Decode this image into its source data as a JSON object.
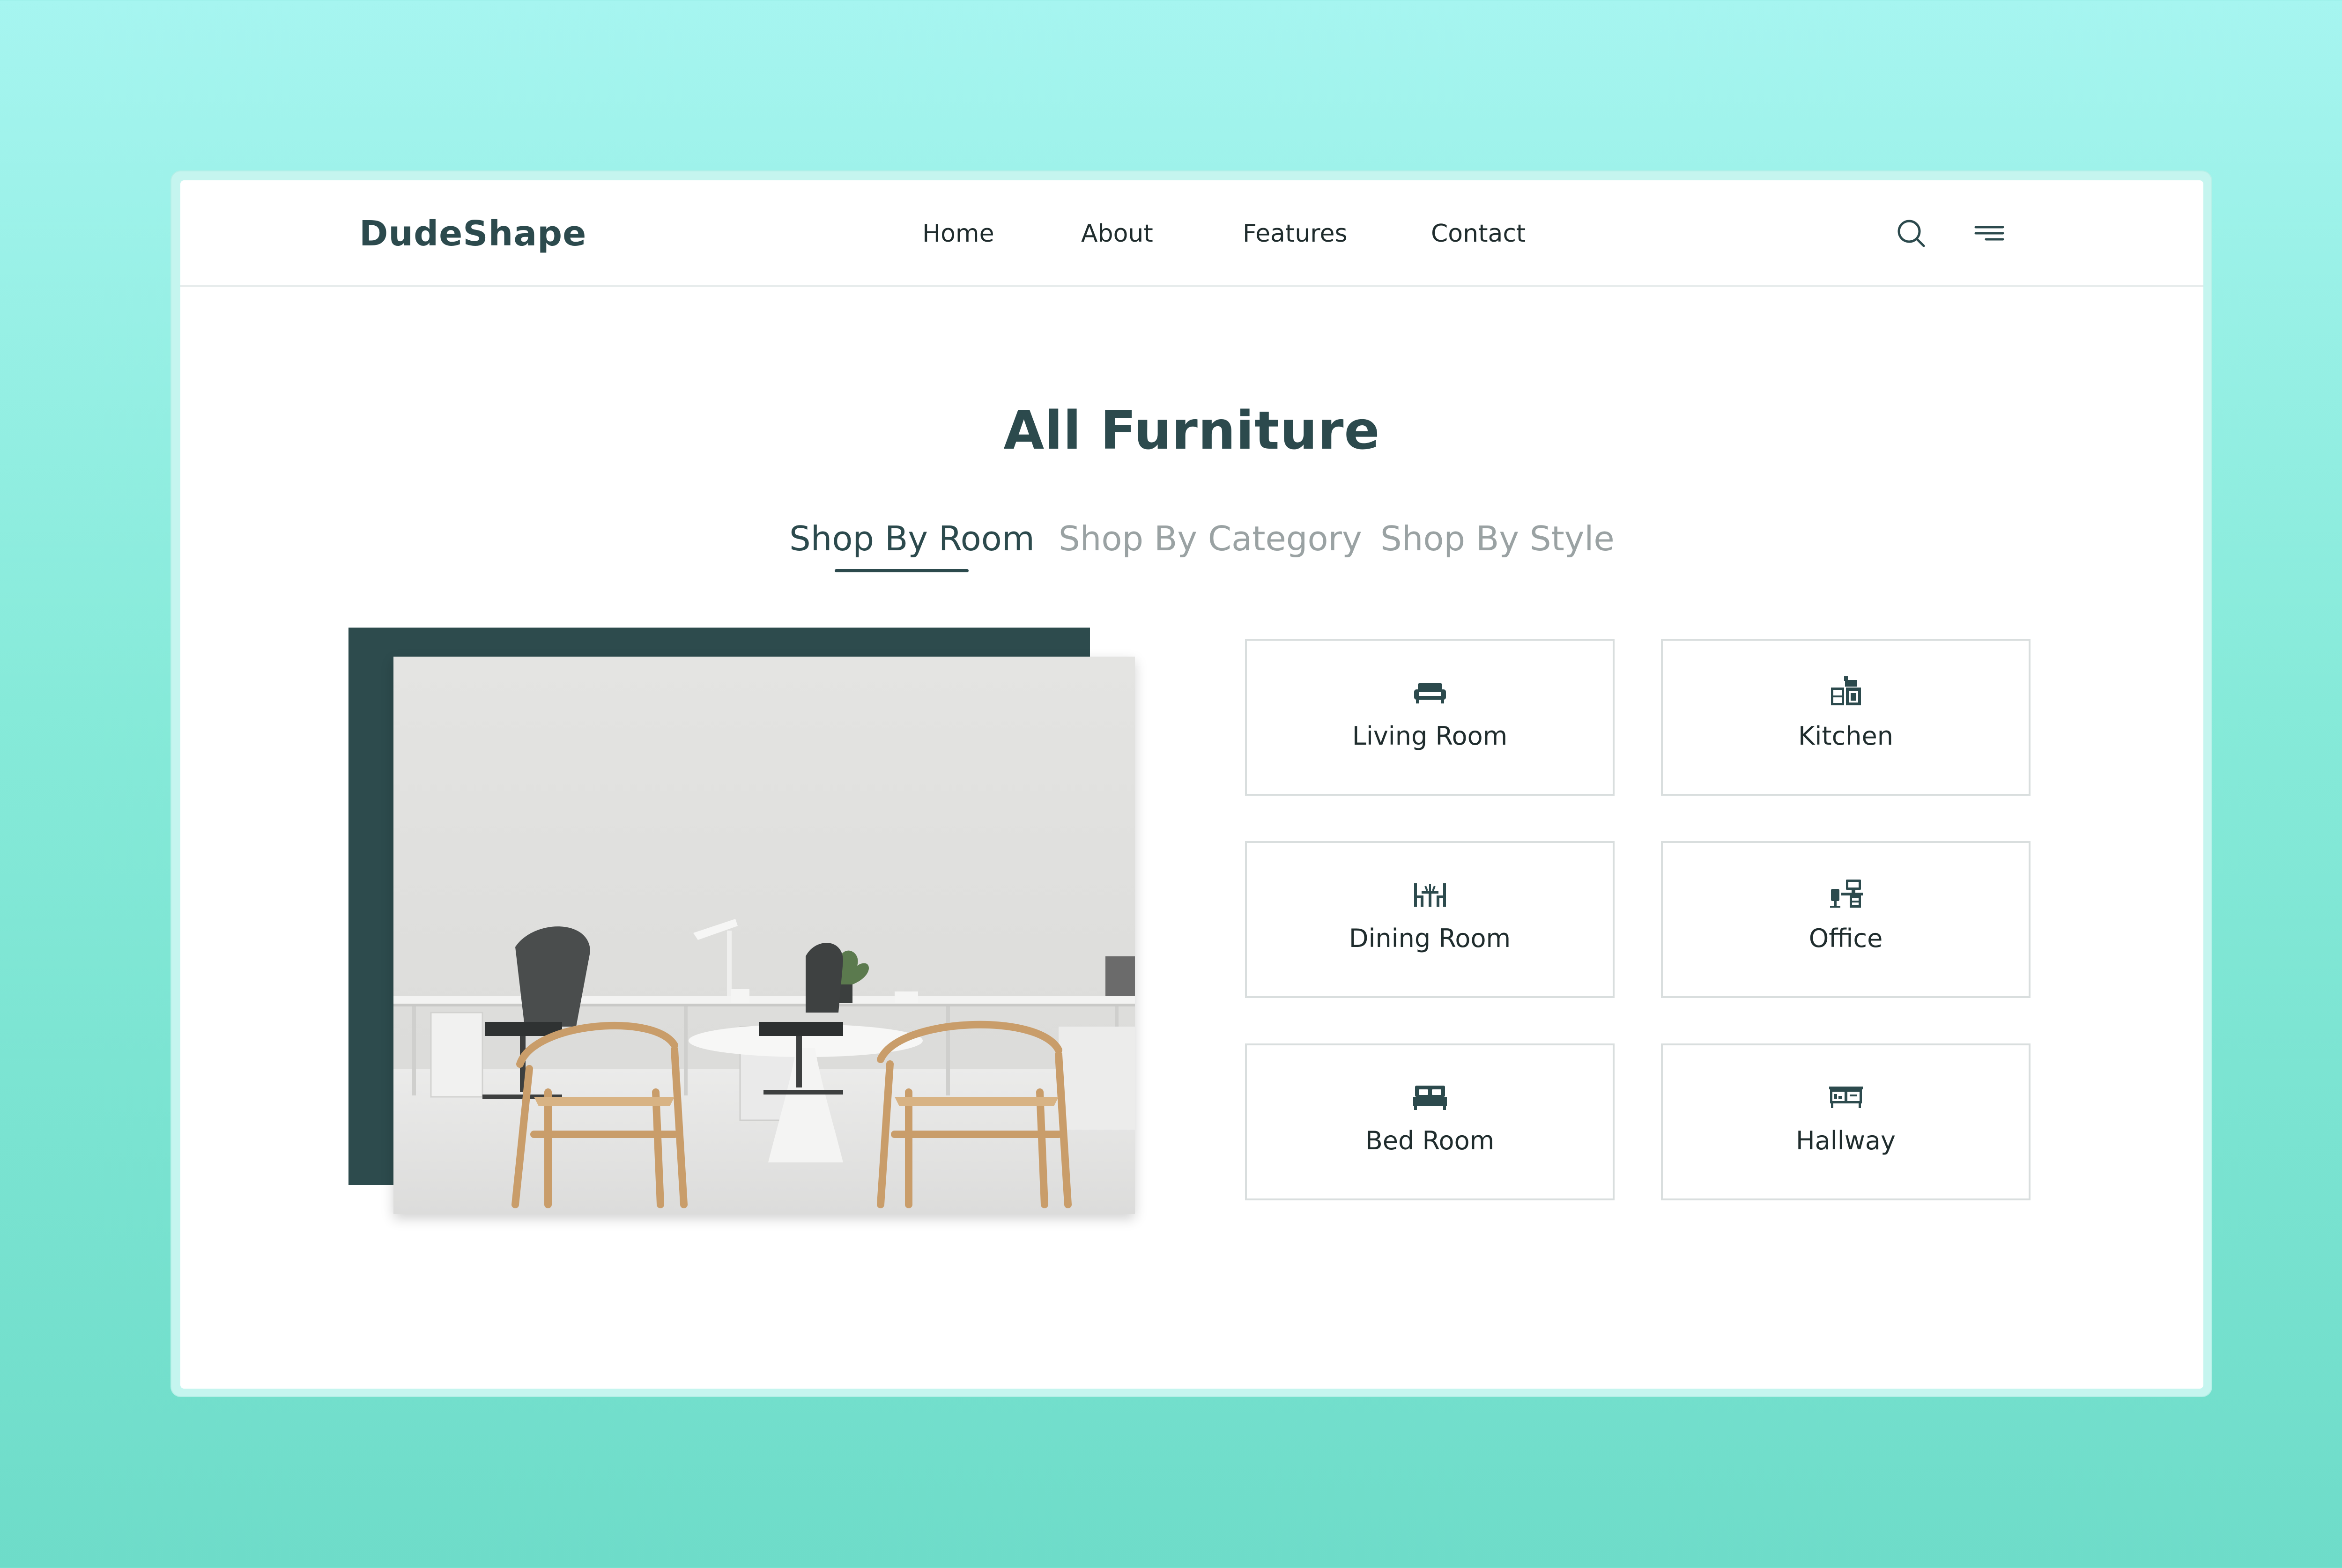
{
  "brand": {
    "logo": "DudeShape"
  },
  "nav": [
    {
      "label": "Home"
    },
    {
      "label": "About"
    },
    {
      "label": "Features"
    },
    {
      "label": "Contact"
    }
  ],
  "header_icons": [
    "search-icon",
    "menu-icon"
  ],
  "main": {
    "title": "All Furniture",
    "tabs": [
      {
        "label": "Shop By Room",
        "active": true
      },
      {
        "label": "Shop By Category",
        "active": false
      },
      {
        "label": "Shop By Style",
        "active": false
      }
    ],
    "rooms": [
      {
        "label": "Living Room",
        "icon": "sofa-icon"
      },
      {
        "label": "Kitchen",
        "icon": "kitchen-icon"
      },
      {
        "label": "Dining Room",
        "icon": "dining-table-icon"
      },
      {
        "label": "Office",
        "icon": "office-desk-icon"
      },
      {
        "label": "Bed Room",
        "icon": "bed-icon"
      },
      {
        "label": "Hallway",
        "icon": "hallway-cabinet-icon"
      }
    ]
  },
  "colors": {
    "accent": "#2c4a4d",
    "muted_tab": "#9aa2a3",
    "background_top": "#a6f5f0",
    "background_bottom": "#6edcc9"
  }
}
